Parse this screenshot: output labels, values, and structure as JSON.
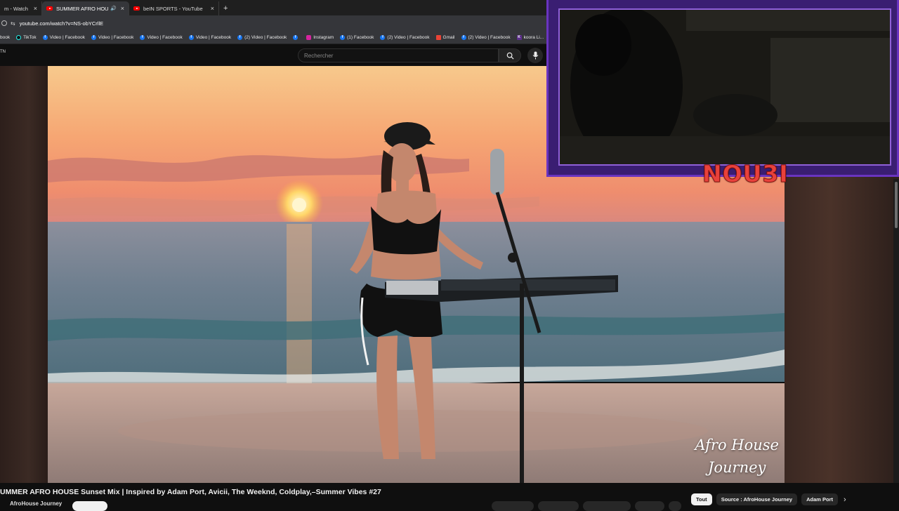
{
  "tabs": [
    {
      "title": "m - Watch Li...",
      "active": false
    },
    {
      "title": "SUMMER AFRO HOUSE Su...",
      "active": true,
      "audio": "🔊"
    },
    {
      "title": "beIN SPORTS - YouTube",
      "active": false
    }
  ],
  "tab_close": "×",
  "new_tab": "+",
  "address": {
    "url": "youtube.com/watch?v=NS-obYCrllE"
  },
  "bookmarks": [
    {
      "label": "book",
      "icon": "none"
    },
    {
      "label": "TikTok",
      "icon": "tt"
    },
    {
      "label": "Video | Facebook",
      "icon": "fb"
    },
    {
      "label": "Video | Facebook",
      "icon": "fb"
    },
    {
      "label": "Video | Facebook",
      "icon": "fb"
    },
    {
      "label": "Video | Facebook",
      "icon": "fb"
    },
    {
      "label": "(2) Video | Facebook",
      "icon": "fb"
    },
    {
      "label": "",
      "icon": "fb"
    },
    {
      "label": "Instagram",
      "icon": "ig"
    },
    {
      "label": "(1) Facebook",
      "icon": "fb"
    },
    {
      "label": "(2) Video | Facebook",
      "icon": "fb"
    },
    {
      "label": "Gmail",
      "icon": "gm"
    },
    {
      "label": "(2) Video | Facebook",
      "icon": "fb"
    },
    {
      "label": "koora Li...",
      "icon": "k"
    }
  ],
  "youtube": {
    "logo_fragment": "TN",
    "search_placeholder": "Rechercher"
  },
  "video": {
    "watermark_line1": "Afro House",
    "watermark_line2": "Journey"
  },
  "overlay": {
    "nickname": "NOU3I"
  },
  "below": {
    "title": "UMMER AFRO HOUSE Sunset Mix | Inspired by Adam Port, Avicii, The Weeknd, Coldplay,–Summer Vibes #27",
    "channel": "AfroHouse Journey"
  },
  "chips": [
    "Tout",
    "Source : AfroHouse Journey",
    "Adam Port"
  ],
  "chip_next": "›",
  "colors": {
    "accent_red": "#ff0000",
    "overlay_purple": "#3a1e72",
    "nick_red": "#e8413b"
  }
}
